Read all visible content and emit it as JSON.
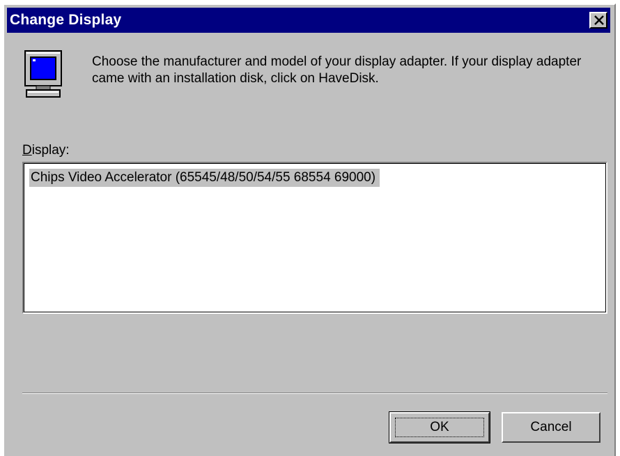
{
  "window": {
    "title": "Change Display"
  },
  "dialog": {
    "instructions": "Choose the manufacturer and model of your display adapter.  If your display adapter came with an installation disk, click on HaveDisk.",
    "display_label_underlined": "D",
    "display_label_rest": "isplay:",
    "display_list": [
      {
        "label": "Chips Video Accelerator (65545/48/50/54/55 68554 69000)",
        "selected": true
      }
    ]
  },
  "buttons": {
    "ok_label": "OK",
    "cancel_label": "Cancel"
  },
  "icons": {
    "close": "close-icon",
    "monitor": "monitor-icon"
  },
  "colors": {
    "titlebar": "#000080",
    "face": "#c0c0c0",
    "selection": "#c0c0c0",
    "screen": "#0000ff"
  }
}
